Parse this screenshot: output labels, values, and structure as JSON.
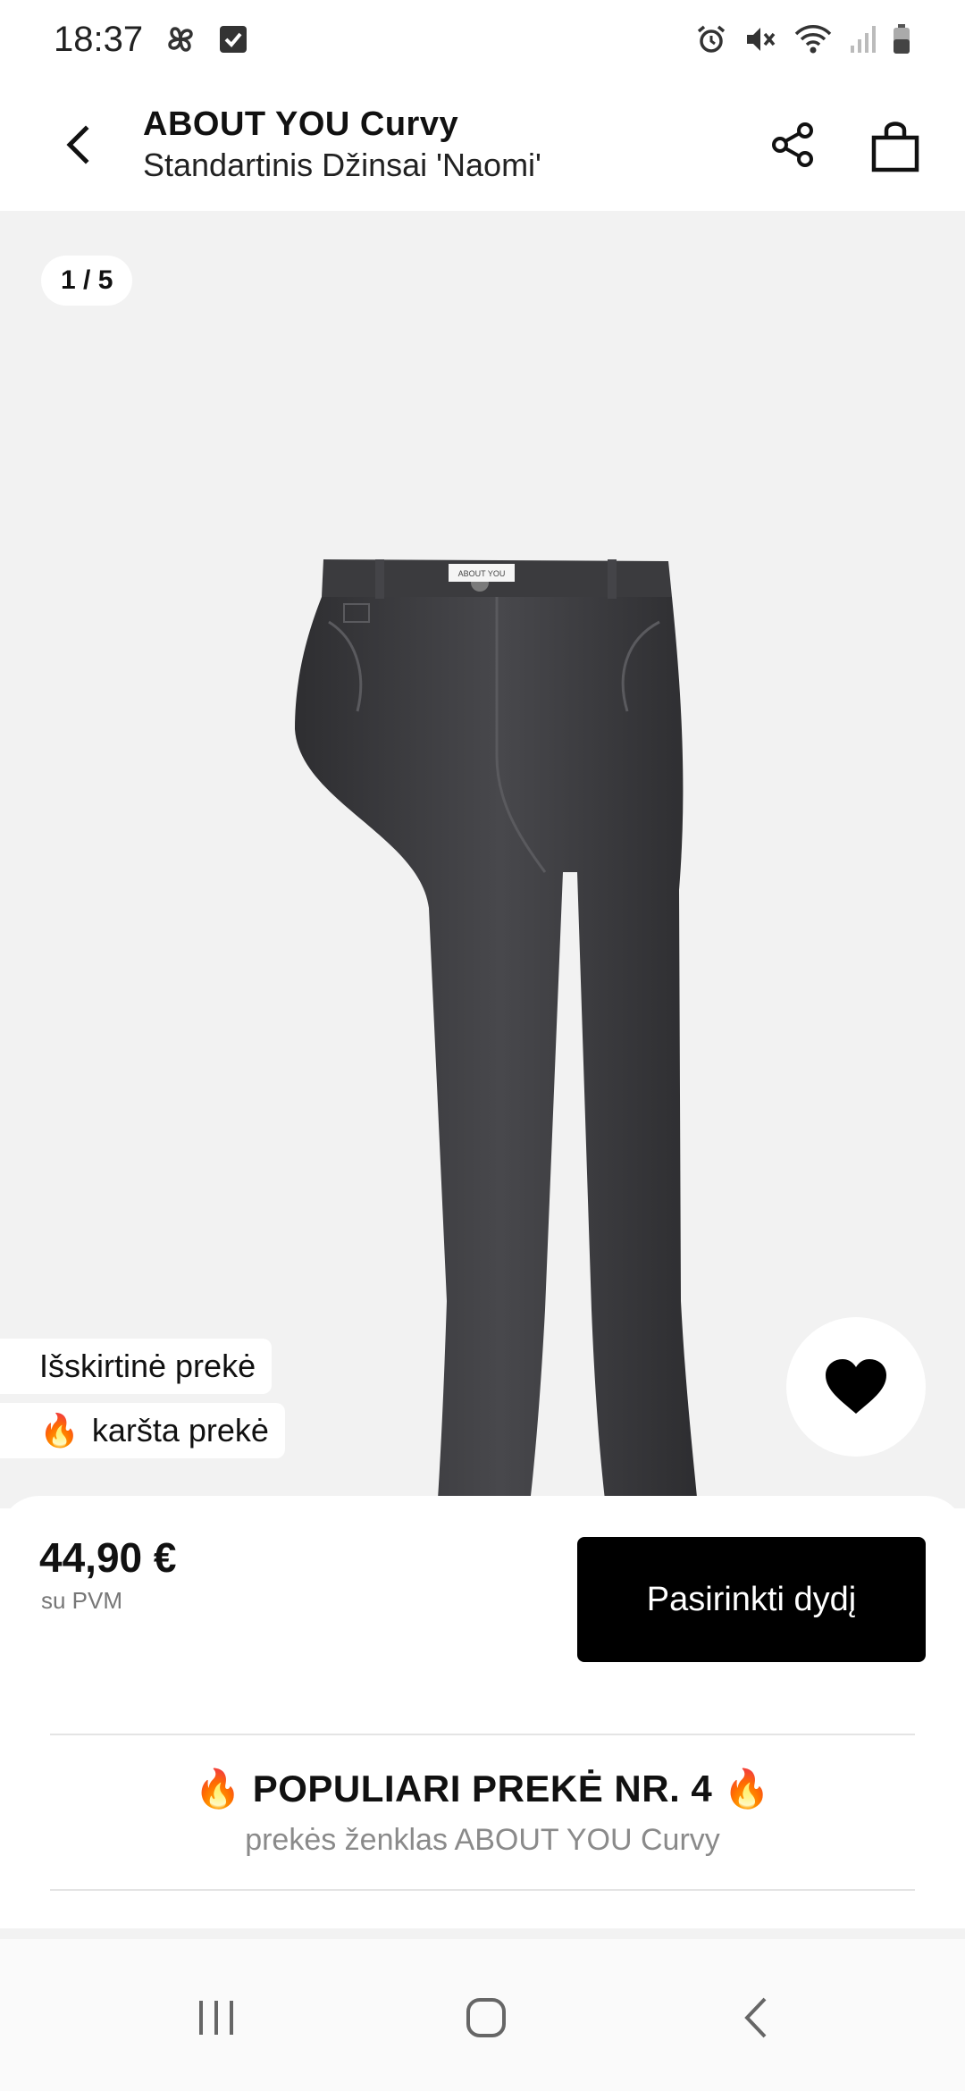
{
  "status_bar": {
    "time": "18:37",
    "icons": [
      "pinwheel-icon",
      "checkbox-icon",
      "alarm-icon",
      "mute-icon",
      "wifi-icon",
      "signal-icon",
      "battery-icon"
    ]
  },
  "header": {
    "brand": "ABOUT YOU Curvy",
    "product_name": "Standartinis Džinsai 'Naomi'",
    "icons": {
      "back": "back-arrow-icon",
      "share": "share-icon",
      "bag": "shopping-bag-icon"
    }
  },
  "gallery": {
    "pager": "1 / 5",
    "label_on_product": "ABOUT YOU",
    "tags": {
      "exclusive": "Išskirtinė prekė",
      "hot_flame": "🔥",
      "hot": "karšta prekė"
    },
    "wishlist_icon": "heart-icon"
  },
  "purchase": {
    "price": "44,90 €",
    "vat_note": "su PVM",
    "choose_size_button": "Pasirinkti dydį"
  },
  "popularity": {
    "title": "🔥 POPULIARI PREKĖ NR. 4 🔥",
    "subtitle": "prekės ženklas ABOUT YOU Curvy"
  },
  "nav_bar": {
    "icons": [
      "recents-icon",
      "home-icon",
      "back-icon"
    ]
  },
  "colors": {
    "accent": "#000000",
    "image_background": "#f2f2f2",
    "denim": "#3a3a3d",
    "muted_text": "#8a8a8a"
  }
}
